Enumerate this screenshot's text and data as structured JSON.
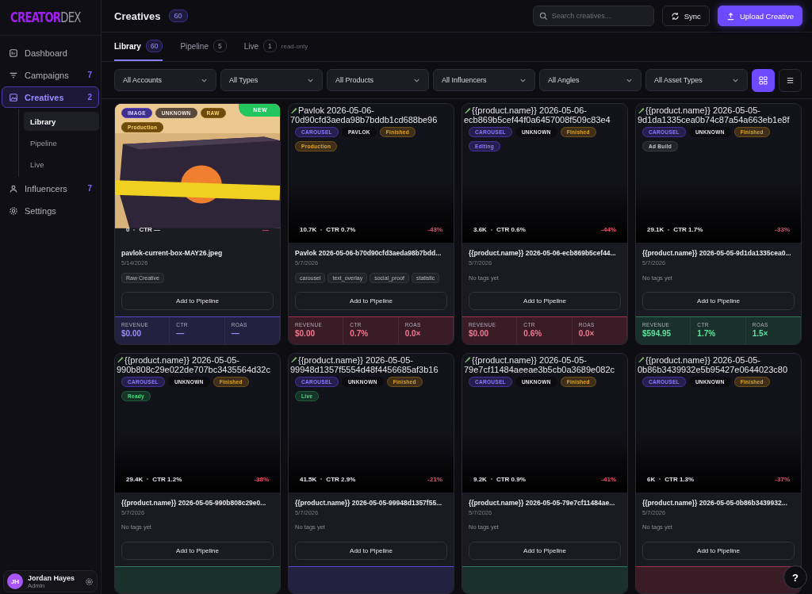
{
  "sidebar": {
    "logo": {
      "part1": "CREATOR",
      "part2": "DEX"
    },
    "nav": [
      {
        "label": "Dashboard",
        "selected": false
      },
      {
        "label": "Campaigns",
        "count": "7",
        "selected": false
      },
      {
        "label": "Creatives",
        "count": "2",
        "selected": true,
        "children": [
          {
            "label": "Library",
            "selected": true
          },
          {
            "label": "Pipeline",
            "selected": false
          },
          {
            "label": "Live",
            "selected": false
          }
        ]
      },
      {
        "label": "Influencers",
        "count": "7",
        "selected": false
      },
      {
        "label": "Settings",
        "selected": false
      }
    ],
    "user": {
      "initials": "JH",
      "name": "Jordan Hayes",
      "role": "Admin"
    }
  },
  "header": {
    "title": "Creatives",
    "count": "60",
    "search": {
      "placeholder": "Search creatives..."
    },
    "sync_button": "Sync",
    "upload_button": "Upload Creative"
  },
  "tabs": [
    {
      "label": "Library",
      "count": "60",
      "selected": true
    },
    {
      "label": "Pipeline",
      "count": "5",
      "selected": false
    },
    {
      "label": "Live",
      "count": "1",
      "note": "read-only",
      "selected": false
    }
  ],
  "filters": [
    "All Accounts",
    "All Types",
    "All Products",
    "All Influencers",
    "All Angles",
    "All Asset Types"
  ],
  "view_toggle": [
    {
      "kind": "grid",
      "selected": true
    },
    {
      "kind": "list",
      "selected": false
    }
  ],
  "cards": [
    {
      "new_badge": "NEW",
      "badges": [
        {
          "label": "IMAGE",
          "kind": "purple"
        },
        {
          "label": "UNKNOWN",
          "kind": "brown"
        },
        {
          "label": "RAW",
          "kind": "amber"
        }
      ],
      "status": {
        "label": "Production",
        "kind": "amber"
      },
      "views": "0",
      "ctr": "CTR —",
      "delta": "—",
      "title": "pavlok-current-box-MAY26.jpeg",
      "date": "5/14/2026",
      "tags": [
        "Raw Creative"
      ],
      "action": "Add to Pipeline",
      "metrics": {
        "kind": "purple",
        "items": [
          {
            "label": "REVENUE",
            "value": "$0.00"
          },
          {
            "label": "CTR",
            "value": "—"
          },
          {
            "label": "ROAS",
            "value": "—"
          }
        ]
      }
    },
    {
      "kind": "broken",
      "alt_lines": [
        "Pavlok 2026-05-06-",
        "70d90cfd3aeda98b7bddb1cd688be96"
      ],
      "badges": [
        {
          "label": "CAROUSEL",
          "kind": "purple"
        },
        {
          "label": "PAVLOK",
          "kind": "dark"
        },
        {
          "label": "Finished",
          "kind": "amber"
        }
      ],
      "status": {
        "label": "Production",
        "kind": "amber"
      },
      "views": "10.7K",
      "ctr": "CTR 0.7%",
      "delta": "-43%",
      "title": "Pavlok 2026-05-06-b70d90cfd3aeda98b7bdd...",
      "date": "5/7/2026",
      "tags": [
        "carousel",
        "text_overlay",
        "social_proof",
        "statistic"
      ],
      "action": "Add to Pipeline",
      "metrics": {
        "kind": "red",
        "items": [
          {
            "label": "REVENUE",
            "value": "$0.00"
          },
          {
            "label": "CTR",
            "value": "0.7%"
          },
          {
            "label": "ROAS",
            "value": "0.0×"
          }
        ]
      }
    },
    {
      "kind": "broken",
      "alt_lines": [
        "{{product.name}} 2026-05-06-",
        "ecb869b5cef44f0a6457008f509c83e4"
      ],
      "badges": [
        {
          "label": "CAROUSEL",
          "kind": "purple"
        },
        {
          "label": "UNKNOWN",
          "kind": "dark"
        },
        {
          "label": "Finished",
          "kind": "amber"
        }
      ],
      "status": {
        "label": "Editing",
        "kind": "purple"
      },
      "views": "3.6K",
      "ctr": "CTR 0.6%",
      "delta": "-44%",
      "title": "{{product.name}} 2026-05-06-ecb869b5cef44...",
      "date": "5/7/2026",
      "no_tags": "No tags yet",
      "action": "Add to Pipeline",
      "metrics": {
        "kind": "red",
        "items": [
          {
            "label": "REVENUE",
            "value": "$0.00"
          },
          {
            "label": "CTR",
            "value": "0.6%"
          },
          {
            "label": "ROAS",
            "value": "0.0×"
          }
        ]
      }
    },
    {
      "kind": "broken",
      "alt_lines": [
        "{{product.name}} 2026-05-05-",
        "9d1da1335cea0b74c87a54a663eb1e8f"
      ],
      "badges": [
        {
          "label": "CAROUSEL",
          "kind": "purple"
        },
        {
          "label": "UNKNOWN",
          "kind": "dark"
        },
        {
          "label": "Finished",
          "kind": "amber"
        }
      ],
      "status": {
        "label": "Ad Build",
        "kind": "grey"
      },
      "views": "29.1K",
      "ctr": "CTR 1.7%",
      "delta": "-33%",
      "title": "{{product.name}} 2026-05-05-9d1da1335cea0...",
      "date": "5/7/2026",
      "no_tags": "No tags yet",
      "action": "Add to Pipeline",
      "metrics": {
        "kind": "green",
        "items": [
          {
            "label": "REVENUE",
            "value": "$594.95"
          },
          {
            "label": "CTR",
            "value": "1.7%"
          },
          {
            "label": "ROAS",
            "value": "1.5×"
          }
        ]
      }
    },
    {
      "kind": "broken",
      "alt_lines": [
        "{{product.name}} 2026-05-05-",
        "990b808c29e022de707bc3435564d32c"
      ],
      "badges": [
        {
          "label": "CAROUSEL",
          "kind": "purple"
        },
        {
          "label": "UNKNOWN",
          "kind": "dark"
        },
        {
          "label": "Finished",
          "kind": "amber"
        }
      ],
      "status": {
        "label": "Ready",
        "kind": "green"
      },
      "views": "29.4K",
      "ctr": "CTR 1.2%",
      "delta": "-38%",
      "title": "{{product.name}} 2026-05-05-990b808c29e0...",
      "date": "5/7/2026",
      "no_tags": "No tags yet",
      "action": "Add to Pipeline",
      "metrics": {
        "kind": "green"
      }
    },
    {
      "kind": "broken",
      "alt_lines": [
        "{{product.name}} 2026-05-05-",
        "99948d1357f5554d48f4456685af3b16"
      ],
      "badges": [
        {
          "label": "CAROUSEL",
          "kind": "purple"
        },
        {
          "label": "UNKNOWN",
          "kind": "dark"
        },
        {
          "label": "Finished",
          "kind": "amber"
        }
      ],
      "status": {
        "label": "Live",
        "kind": "green"
      },
      "views": "41.5K",
      "ctr": "CTR 2.9%",
      "delta": "-21%",
      "title": "{{product.name}} 2026-05-05-99948d1357f55...",
      "date": "5/7/2026",
      "no_tags": "No tags yet",
      "action": "Add to Pipeline",
      "metrics": {
        "kind": "purple"
      }
    },
    {
      "kind": "broken",
      "alt_lines": [
        "{{product.name}} 2026-05-05-",
        "79e7cf11484aeeae3b5cb0a3689e082c"
      ],
      "badges": [
        {
          "label": "CAROUSEL",
          "kind": "purple"
        },
        {
          "label": "UNKNOWN",
          "kind": "dark"
        },
        {
          "label": "Finished",
          "kind": "amber"
        }
      ],
      "views": "9.2K",
      "ctr": "CTR 0.9%",
      "delta": "-41%",
      "title": "{{product.name}} 2026-05-05-79e7cf11484ae...",
      "date": "5/7/2026",
      "no_tags": "No tags yet",
      "action": "Add to Pipeline",
      "metrics": {
        "kind": "green"
      }
    },
    {
      "kind": "broken",
      "alt_lines": [
        "{{product.name}} 2026-05-05-",
        "0b86b3439932e5b95427e0644023c80"
      ],
      "badges": [
        {
          "label": "CAROUSEL",
          "kind": "purple"
        },
        {
          "label": "UNKNOWN",
          "kind": "dark"
        },
        {
          "label": "Finished",
          "kind": "amber"
        }
      ],
      "views": "6K",
      "ctr": "CTR 1.3%",
      "delta": "-37%",
      "title": "{{product.name}} 2026-05-05-0b86b3439932...",
      "date": "5/7/2026",
      "no_tags": "No tags yet",
      "action": "Add to Pipeline",
      "metrics": {
        "kind": "red"
      }
    }
  ],
  "help_button": "?"
}
